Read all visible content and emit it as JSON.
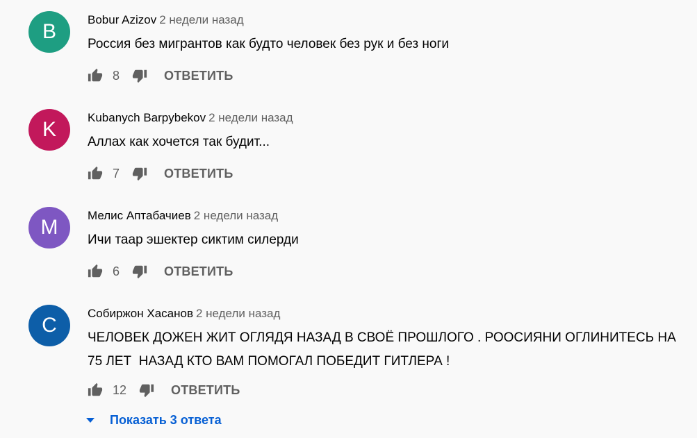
{
  "comments": [
    {
      "avatar_letter": "B",
      "avatar_color": "#1e9e82",
      "author": "Bobur Azizov",
      "time": "2 недели назад",
      "text": "Россия без мигрантов как будто человек без рук и без ноги",
      "likes": "8",
      "reply_label": "ОТВЕТИТЬ"
    },
    {
      "avatar_letter": "K",
      "avatar_color": "#c2185b",
      "author": "Kubanych Barpybekov",
      "time": "2 недели назад",
      "text": "Аллах как хочется так будит...",
      "likes": "7",
      "reply_label": "ОТВЕТИТЬ"
    },
    {
      "avatar_letter": "M",
      "avatar_color": "#7e57c2",
      "author": "Мелис Аптабачиев",
      "time": "2 недели назад",
      "text": "Ичи таар эшектер сиктим силерди",
      "likes": "6",
      "reply_label": "ОТВЕТИТЬ"
    },
    {
      "avatar_letter": "C",
      "avatar_color": "#0d5ea8",
      "author": "Собиржон Хасанов",
      "time": "2 недели назад",
      "text": "ЧЕЛОВЕК ДОЖЕН ЖИТ ОГЛЯДЯ НАЗАД В СВОЁ ПРОШЛОГО . РООСИЯНИ ОГЛИНИТЕСЬ НА 75 ЛЕТ  НАЗАД КТО ВАМ ПОМОГАЛ ПОБЕДИТ ГИТЛЕРА !",
      "likes": "12",
      "reply_label": "ОТВЕТИТЬ"
    }
  ],
  "show_replies_label": "Показать 3 ответа",
  "icons": {
    "like": "thumb-up-icon",
    "dislike": "thumb-down-icon",
    "expand": "caret-down-icon"
  },
  "colors": {
    "link": "#065fd4",
    "secondary_text": "#606060",
    "primary_text": "#030303"
  }
}
